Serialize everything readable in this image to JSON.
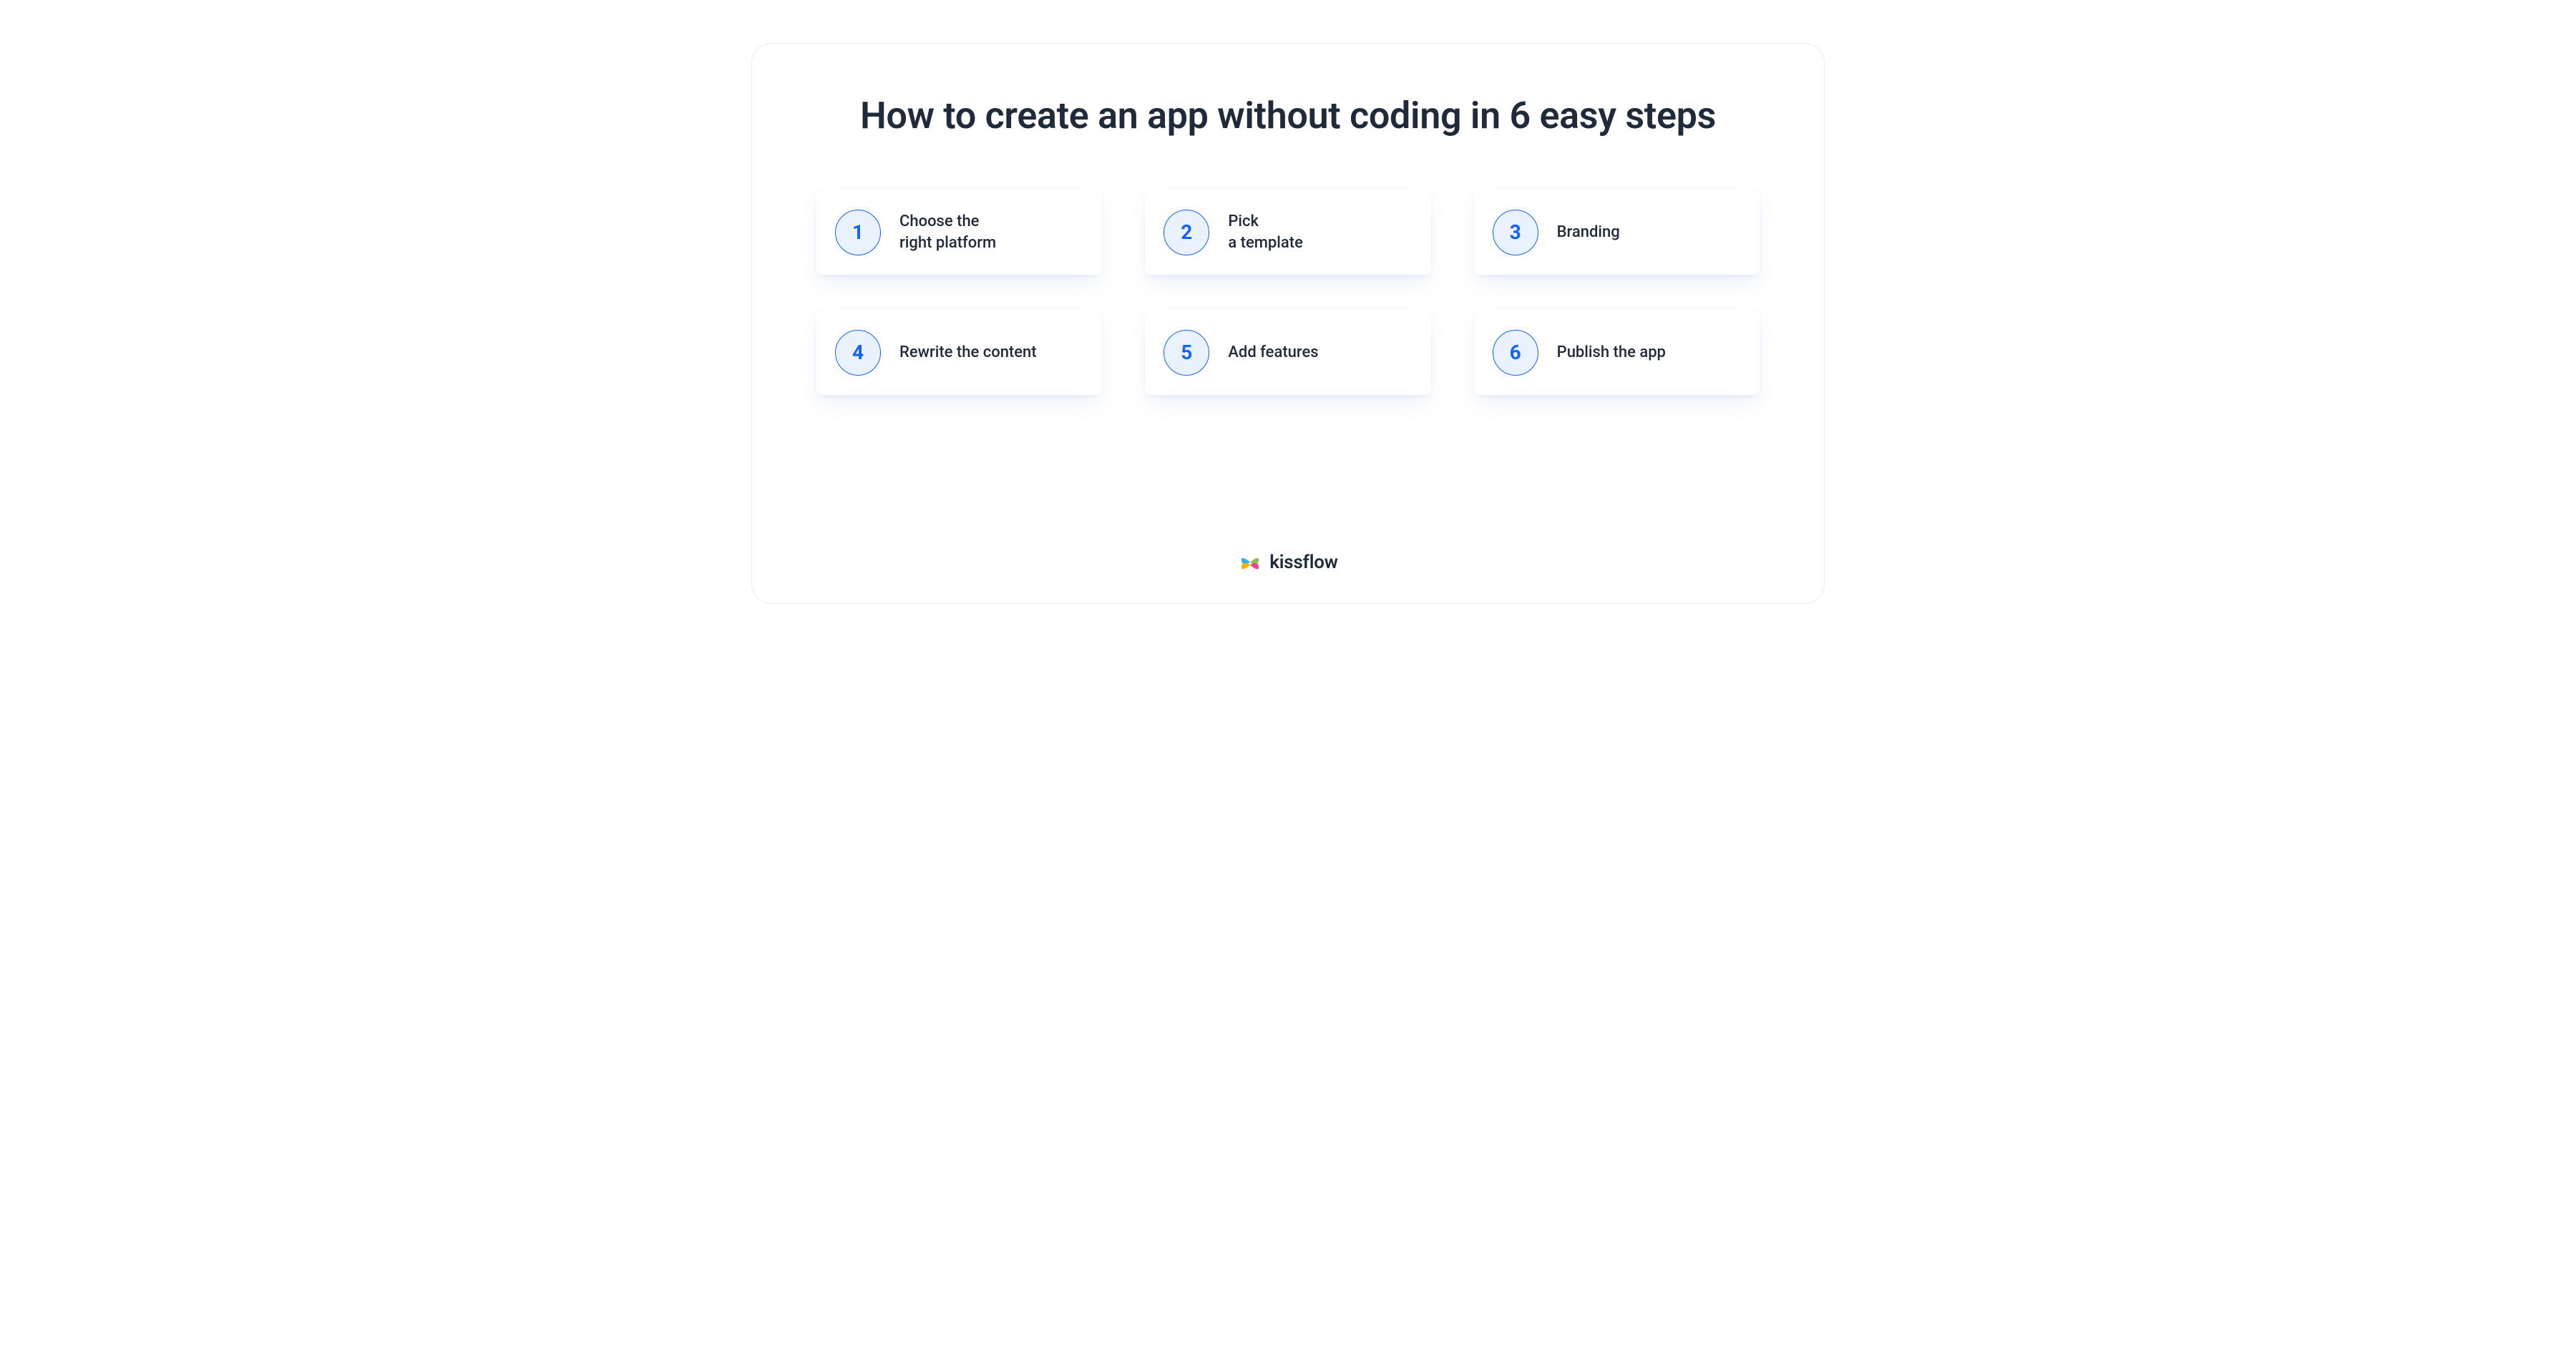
{
  "title": "How to create an app\nwithout coding in 6 easy steps",
  "steps": [
    {
      "num": "1",
      "label": "Choose the\nright platform"
    },
    {
      "num": "2",
      "label": "Pick\na template"
    },
    {
      "num": "3",
      "label": "Branding"
    },
    {
      "num": "4",
      "label": "Rewrite the content"
    },
    {
      "num": "5",
      "label": "Add features"
    },
    {
      "num": "6",
      "label": "Publish the app"
    }
  ],
  "brand": {
    "name": "kissflow"
  },
  "colors": {
    "text": "#1f2a3a",
    "accent": "#1463ff",
    "accent_bg": "#eaf2ff"
  }
}
